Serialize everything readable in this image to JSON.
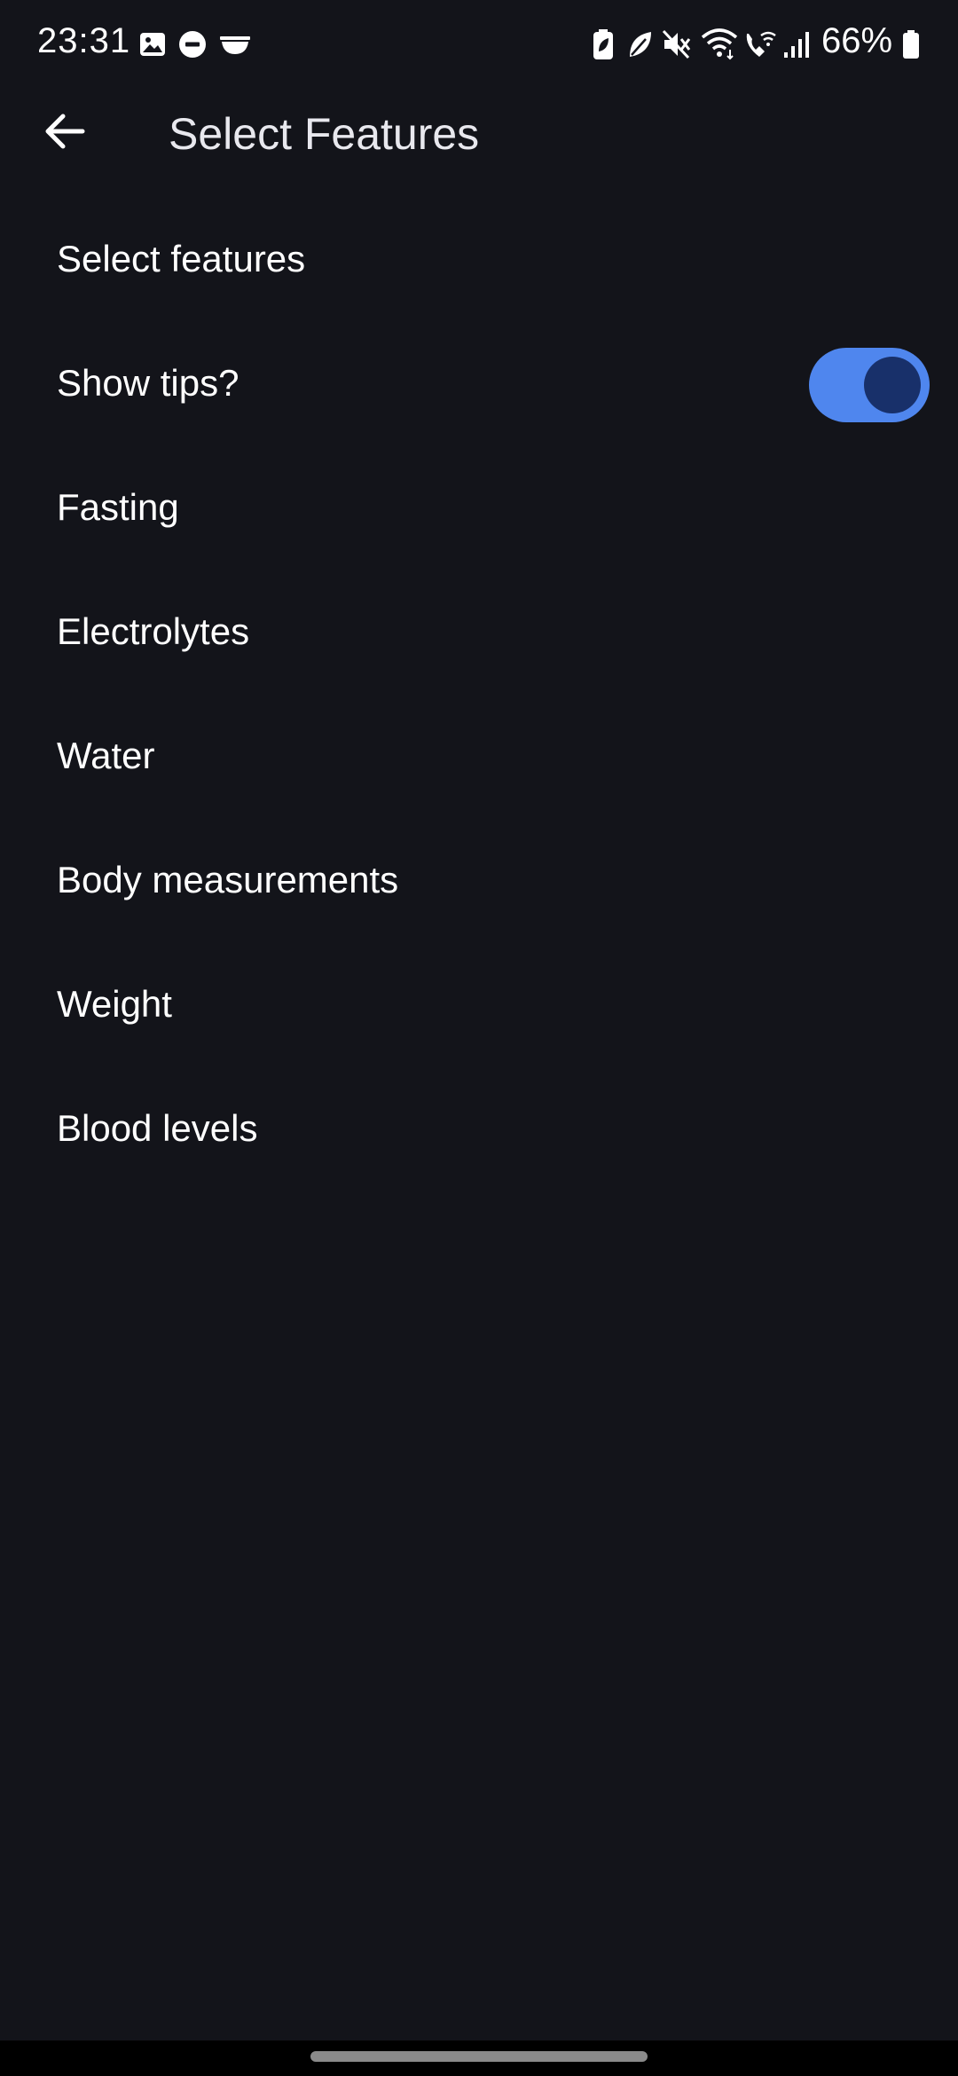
{
  "status_bar": {
    "time": "23:31",
    "battery_percent": "66%",
    "left_icons": [
      "image-icon",
      "do-not-disturb-icon",
      "bowl-icon"
    ],
    "right_icons": [
      "battery-saver-icon",
      "leaf-icon",
      "mute-icon",
      "wifi-icon",
      "wifi-call-icon",
      "signal-icon",
      "battery-icon"
    ]
  },
  "app_bar": {
    "title": "Select Features",
    "back_icon": "arrow-back-icon"
  },
  "list": {
    "header": "Select features",
    "items": [
      {
        "label": "Show tips?",
        "toggle_on": true
      },
      {
        "label": "Fasting"
      },
      {
        "label": "Electrolytes"
      },
      {
        "label": "Water"
      },
      {
        "label": "Body measurements"
      },
      {
        "label": "Weight"
      },
      {
        "label": "Blood levels"
      }
    ]
  },
  "colors": {
    "background": "#13141a",
    "toggle_track": "#4f86ee",
    "toggle_knob": "#18306a",
    "text": "#ffffff"
  }
}
